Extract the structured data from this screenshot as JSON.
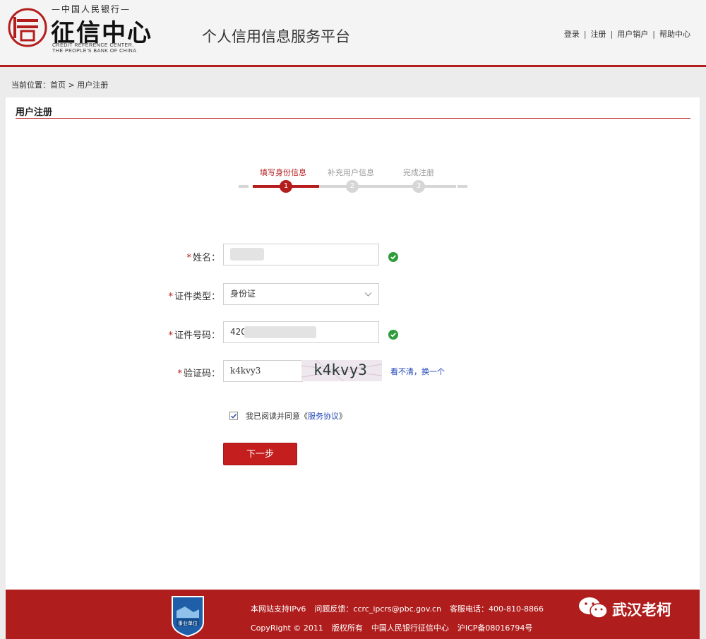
{
  "header": {
    "logo_top": "—中国人民银行—",
    "logo_main": "征信中心",
    "logo_en_line1": "CREDIT REFERENCE CENTER,",
    "logo_en_line2": "THE PEOPLE'S BANK OF CHINA",
    "platform_title": "个人信用信息服务平台",
    "nav": [
      "登录",
      "注册",
      "用户销户",
      "帮助中心"
    ],
    "nav_sep": "|"
  },
  "breadcrumb": {
    "prefix": "当前位置：",
    "home": "首页",
    "arrow": " > ",
    "current": "用户注册"
  },
  "panel": {
    "title": "用户注册"
  },
  "steps": [
    {
      "label": "填写身份信息",
      "number": "1",
      "active": true
    },
    {
      "label": "补充用户信息",
      "number": "2",
      "active": false
    },
    {
      "label": "完成注册",
      "number": "3",
      "active": false
    }
  ],
  "form": {
    "required_mark": "*",
    "name_label": "姓名：",
    "name_value": "",
    "idtype_label": "证件类型：",
    "idtype_value": "身份证",
    "idno_label": "证件号码：",
    "idno_value": "420",
    "captcha_label": "验证码：",
    "captcha_value": "k4kvy3",
    "captcha_image_text": "k4kvy3",
    "captcha_refresh": "看不清，换一个",
    "agree_text": "我已阅读并同意《",
    "agree_link": "服务协议",
    "agree_close": "》",
    "agree_checked": true,
    "next_button": "下一步"
  },
  "footer": {
    "badge_text": "事业单位",
    "line1": [
      "本网站支持IPv6",
      "问题反馈：ccrc_ipcrs@pbc.gov.cn",
      "客服电话：400-810-8866"
    ],
    "line2": [
      "CopyRight © 2011",
      "版权所有",
      "中国人民银行征信中心",
      "沪ICP备08016794号"
    ],
    "watermark": "武汉老柯"
  },
  "colors": {
    "brand_red": "#b51d1d",
    "success_green": "#2e9c3a",
    "link_blue": "#2447b9"
  },
  "icons": {
    "logo": "credit-center-logo-icon",
    "valid": "check-circle-icon",
    "dropdown": "chevron-down-icon",
    "wechat": "wechat-icon"
  }
}
